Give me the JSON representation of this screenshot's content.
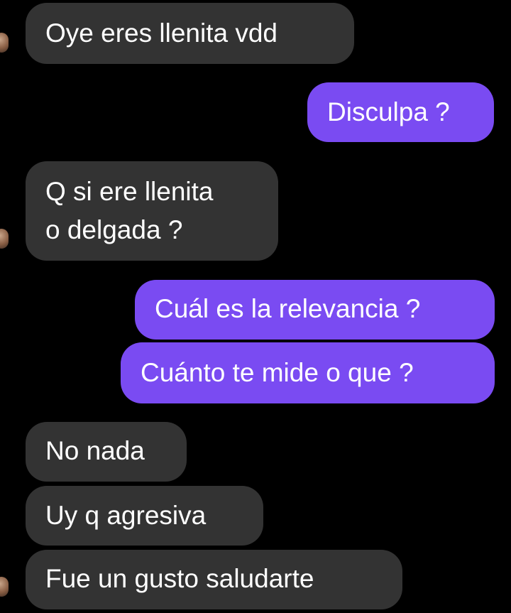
{
  "conversation": {
    "messages": [
      {
        "sender": "other",
        "text": "Oye eres llenita vdd"
      },
      {
        "sender": "me",
        "text": "Disculpa ?"
      },
      {
        "sender": "other",
        "lines": [
          "Q si ere llenita",
          "o delgada ?"
        ]
      },
      {
        "sender": "me",
        "text": "Cuál es la relevancia ?"
      },
      {
        "sender": "me",
        "text": "Cuánto te mide o que ?"
      },
      {
        "sender": "other",
        "text": "No nada"
      },
      {
        "sender": "other",
        "text": "Uy q agresiva"
      },
      {
        "sender": "other",
        "text": "Fue un gusto saludarte"
      }
    ]
  },
  "colors": {
    "background": "#000000",
    "incoming_bubble": "#333333",
    "outgoing_bubble": "#7a4bf2",
    "text": "#ffffff"
  }
}
